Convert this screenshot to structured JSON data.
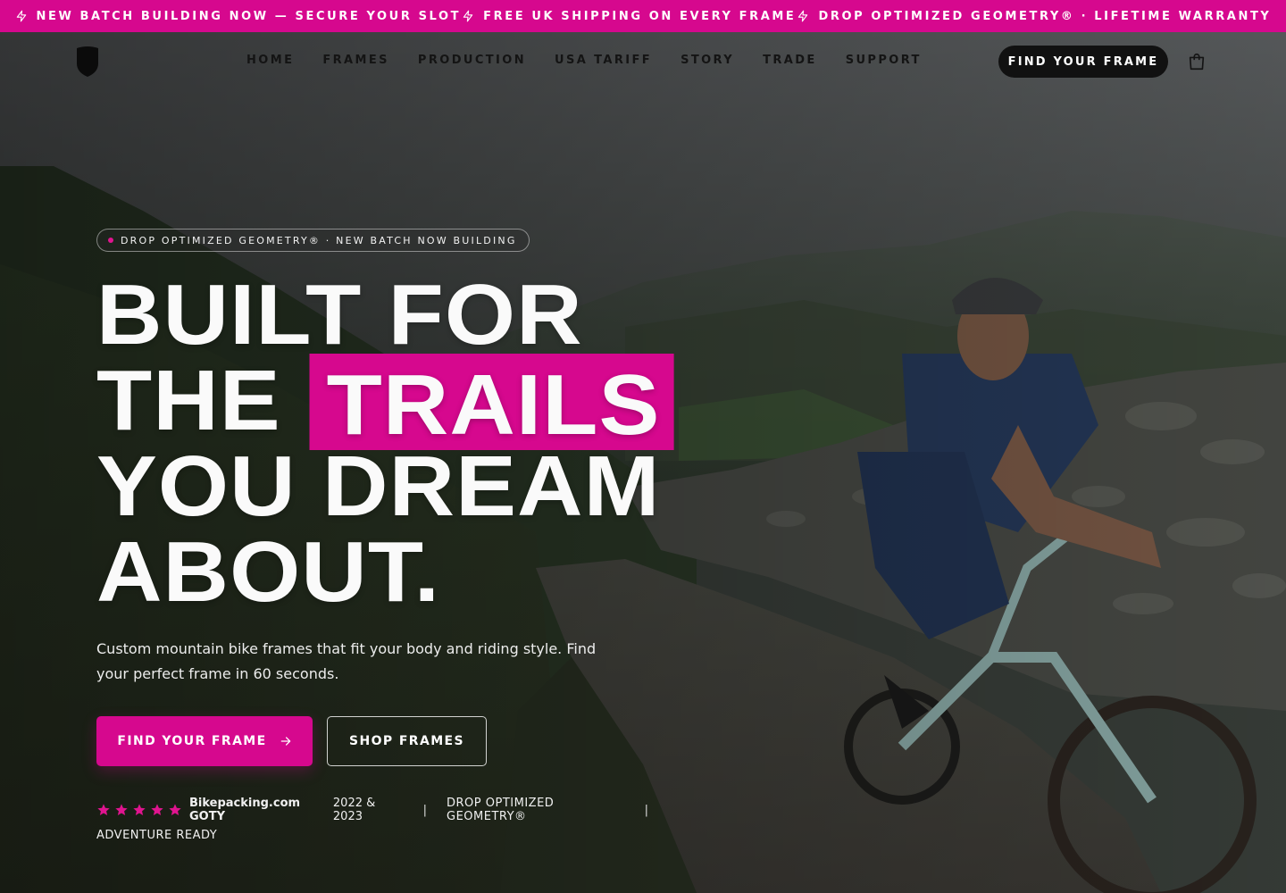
{
  "announcement": {
    "items": [
      {
        "icon": "lightning-icon",
        "text": "NEW BATCH BUILDING NOW — SECURE YOUR SLOT"
      },
      {
        "icon": "lightning-icon",
        "text": "FREE UK SHIPPING ON EVERY FRAME"
      },
      {
        "icon": "lightning-icon",
        "text": "DROP OPTIMIZED GEOMETRY® · LIFETIME WARRANTY"
      }
    ]
  },
  "nav": {
    "logo_icon": "shield-logo-icon",
    "links": [
      "HOME",
      "FRAMES",
      "PRODUCTION",
      "USA TARIFF",
      "STORY",
      "TRADE",
      "SUPPORT"
    ],
    "cta_label": "FIND YOUR FRAME",
    "cart_icon": "shopping-bag-icon"
  },
  "hero": {
    "badge": "DROP OPTIMIZED GEOMETRY® · NEW BATCH NOW BUILDING",
    "headline": {
      "line1": "BUILT FOR",
      "line2_prefix": "THE",
      "line2_highlight": "TRAILS",
      "line3": "YOU DREAM",
      "line4": "ABOUT."
    },
    "subhead": "Custom mountain bike frames that fit your body and riding style. Find your perfect frame in 60 seconds.",
    "primary_button": "FIND YOUR FRAME",
    "primary_button_icon": "arrow-right-icon",
    "secondary_button": "SHOP FRAMES",
    "social_proof": {
      "rating_stars": 5,
      "source": "Bikepacking.com GOTY",
      "years": "2022 & 2023",
      "separator": "|",
      "claim1": "DROP OPTIMIZED GEOMETRY®",
      "claim2": "ADVENTURE READY"
    }
  },
  "colors": {
    "accent": "#d6088e",
    "text": "#ffffff",
    "nav_text": "#141414",
    "dark_button": "#111111"
  }
}
